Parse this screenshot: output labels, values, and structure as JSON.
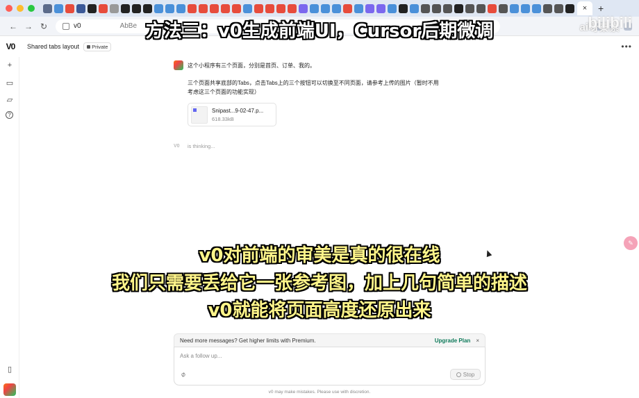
{
  "browser": {
    "active_tab_label": "×",
    "new_tab": "+",
    "url": "v0",
    "url_ghost": "AbBe",
    "nav_back": "←",
    "nav_forward": "→",
    "nav_reload": "↻"
  },
  "app": {
    "logo": "V0",
    "project_name": "Shared tabs layout",
    "visibility": "Private",
    "more": "•••"
  },
  "rail": {
    "new": "+",
    "book": "▭",
    "folder": "▱",
    "help": "?",
    "panel": "▯"
  },
  "message": {
    "line1": "这个小程序有三个页面，分别是首页、订单、我的。",
    "line2": "三个页面共享底部的Tabs，点击Tabs上的三个按钮可以切换至不同页面，请参考上传的图片（暂时不用考虑这三个页面的功能实现）",
    "attachment": {
      "name": "Snipast...9-02-47.p...",
      "size": "618.33kB"
    }
  },
  "thinking": {
    "logo": "V0",
    "text": "is thinking..."
  },
  "overlay": {
    "top_caption": "方法三：v0生成前端UI，Cursor后期微调",
    "caption_line1": "v0对前端的审美是真的很在线",
    "caption_line2": "我们只需要丢给它一张参考图，加上几句简单的描述",
    "caption_line3": "v0就能将页面高度还原出来",
    "watermark": "ai呀秦素",
    "bili": "bilibili"
  },
  "composer": {
    "banner_text": "Need more messages? Get higher limits with Premium.",
    "upgrade_label": "Upgrade Plan",
    "banner_close": "×",
    "placeholder": "Ask a follow up...",
    "stop_label": "Stop",
    "attach_icon": "⌀"
  },
  "disclaimer": "v0 may make mistakes. Please use with discretion.",
  "colors": {
    "accent_green": "#0e7a5a",
    "caption_yellow": "#fff58a"
  }
}
